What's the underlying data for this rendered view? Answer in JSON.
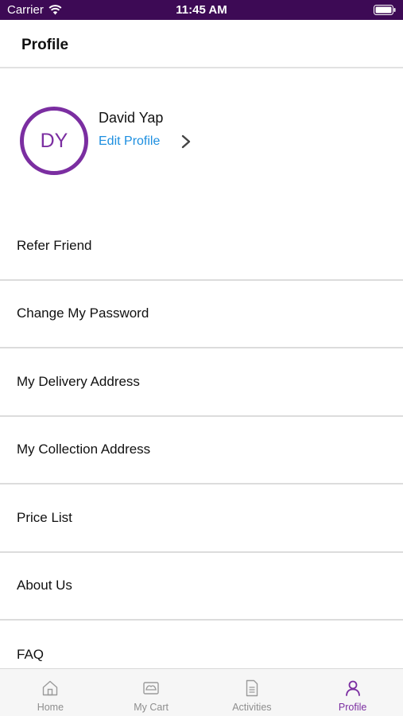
{
  "status_bar": {
    "carrier": "Carrier",
    "time": "11:45 AM"
  },
  "header": {
    "title": "Profile"
  },
  "profile": {
    "initials": "DY",
    "name": "David Yap",
    "edit_label": "Edit Profile"
  },
  "menu_items": [
    "Refer Friend",
    "Change My Password",
    "My Delivery Address",
    "My Collection Address",
    "Price List",
    "About Us",
    "FAQ"
  ],
  "tabs": [
    {
      "label": "Home",
      "icon": "home-icon"
    },
    {
      "label": "My Cart",
      "icon": "cart-icon"
    },
    {
      "label": "Activities",
      "icon": "document-icon"
    },
    {
      "label": "Profile",
      "icon": "person-icon",
      "active": true
    }
  ],
  "colors": {
    "accent": "#7b2ea1",
    "link": "#1d8fe0",
    "status_bar": "#3d0a55"
  }
}
